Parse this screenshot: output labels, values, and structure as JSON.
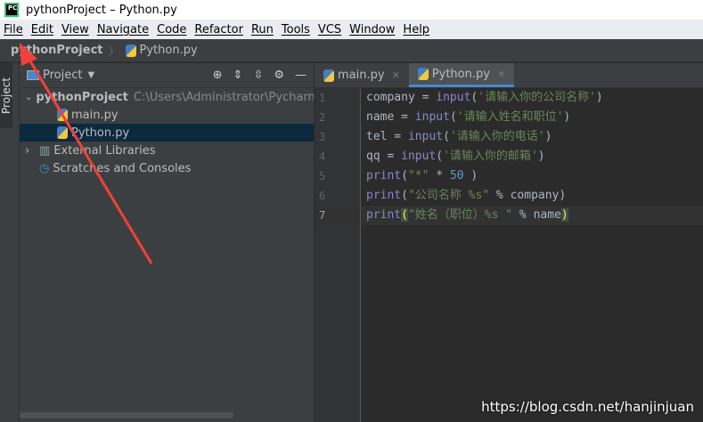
{
  "title": "pythonProject – Python.py",
  "menu": [
    "File",
    "Edit",
    "View",
    "Navigate",
    "Code",
    "Refactor",
    "Run",
    "Tools",
    "VCS",
    "Window",
    "Help"
  ],
  "breadcrumb": {
    "project": "pythonProject",
    "file": "Python.py"
  },
  "sidebar_tab": "Project",
  "panel": {
    "title": "Project",
    "tree": {
      "root": "pythonProject",
      "root_path": "C:\\Users\\Administrator\\PycharmPr",
      "files": [
        "main.py",
        "Python.py"
      ],
      "ext": "External Libraries",
      "scratch": "Scratches and Consoles"
    }
  },
  "tabs": [
    "main.py",
    "Python.py"
  ],
  "line_numbers": [
    "1",
    "2",
    "3",
    "4",
    "5",
    "6",
    "7"
  ],
  "code": {
    "l1": {
      "a": "company = ",
      "f": "input",
      "b": "(",
      "s": "'请输入你的公司名称'",
      "c": ")"
    },
    "l2": {
      "a": "name = ",
      "f": "input",
      "b": "(",
      "s": "'请输入姓名和职位'",
      "c": ")"
    },
    "l3": {
      "a": "tel = ",
      "f": "input",
      "b": "(",
      "s": "'请输入你的电话'",
      "c": ")"
    },
    "l4": {
      "a": "qq = ",
      "f": "input",
      "b": "(",
      "s": "'请输入你的邮箱'",
      "c": ")"
    },
    "l5": {
      "f": "print",
      "b": "(",
      "s": "\"*\"",
      "op": " * ",
      "n": "50",
      "c": " )"
    },
    "l6": {
      "f": "print",
      "b": "(",
      "s": "\"公司名称 %s\"",
      "rest": " % company)"
    },
    "l7": {
      "f": "print",
      "b": "(",
      "s": "\"姓名（职位）%s \"",
      "rest": " % name",
      "c": ")"
    }
  },
  "watermark": "https://blog.csdn.net/hanjinjuan",
  "colors": {
    "annotation_arrow": "#f0413a",
    "selection": "#0d293e"
  }
}
